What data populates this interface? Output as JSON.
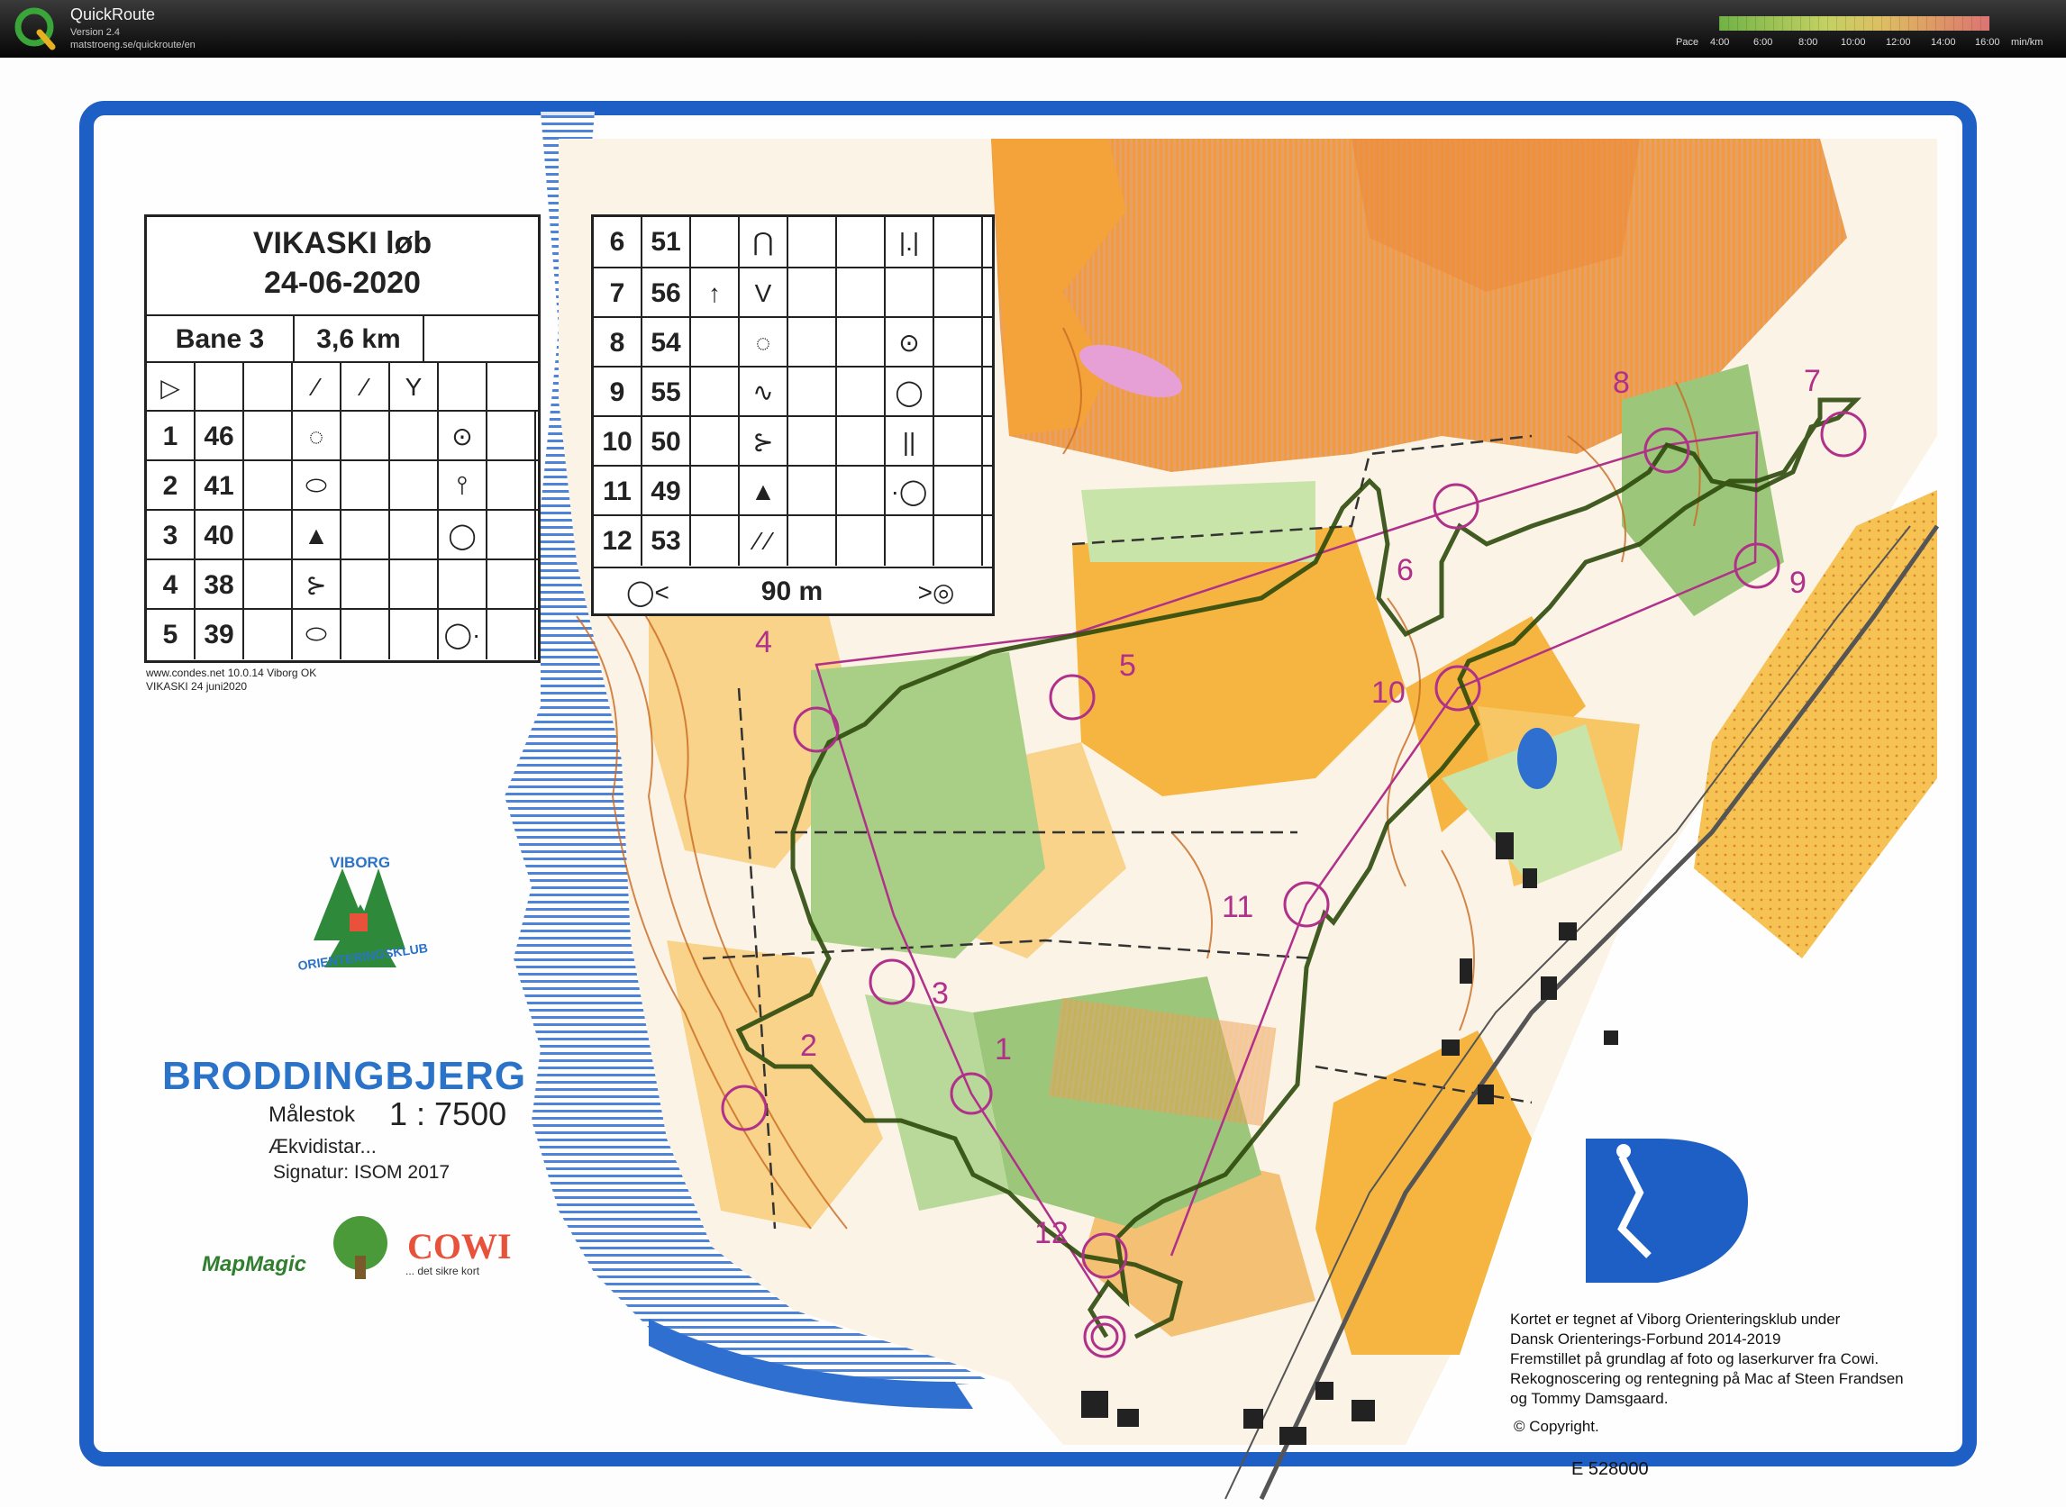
{
  "app": {
    "name": "QuickRoute",
    "version": "Version 2.4",
    "url": "matstroeng.se/quickroute/en",
    "pace_label": "Pace",
    "pace_ticks": [
      "4:00",
      "6:00",
      "8:00",
      "10:00",
      "12:00",
      "14:00",
      "16:00"
    ],
    "pace_unit": "min/km"
  },
  "event": {
    "title": "VIKASKI løb",
    "date": "24-06-2020",
    "course": "Bane 3",
    "length": "3,6 km",
    "finish_distance": "90 m",
    "footer_line1": "www.condes.net 10.0.14 Viborg OK",
    "footer_line2": "VIKASKI 24 juni2020"
  },
  "controls_left": [
    {
      "num": "1",
      "code": "46",
      "sym": "◌",
      "loc": "⊙"
    },
    {
      "num": "2",
      "code": "41",
      "sym": "⬭",
      "loc": "⫯"
    },
    {
      "num": "3",
      "code": "40",
      "sym": "▲",
      "loc": "◯"
    },
    {
      "num": "4",
      "code": "38",
      "sym": "⊱",
      "loc": ""
    },
    {
      "num": "5",
      "code": "39",
      "sym": "⬭",
      "loc": "◯·"
    }
  ],
  "controls_right": [
    {
      "num": "6",
      "code": "51",
      "dir": "",
      "sym": "⋂",
      "loc": "|.|"
    },
    {
      "num": "7",
      "code": "56",
      "dir": "↑",
      "sym": "V",
      "loc": ""
    },
    {
      "num": "8",
      "code": "54",
      "dir": "",
      "sym": "◌",
      "loc": "⊙"
    },
    {
      "num": "9",
      "code": "55",
      "dir": "",
      "sym": "∿",
      "loc": "◯"
    },
    {
      "num": "10",
      "code": "50",
      "dir": "",
      "sym": "⊱",
      "loc": "||"
    },
    {
      "num": "11",
      "code": "49",
      "dir": "",
      "sym": "▲",
      "loc": "·◯"
    },
    {
      "num": "12",
      "code": "53",
      "dir": "",
      "sym": "⁄ ⁄",
      "loc": ""
    }
  ],
  "map": {
    "name": "BRODDINGBJERG",
    "scale_label": "Målestok",
    "scale": "1 : 7500",
    "equidistance": "Ækvidistar...",
    "signature": "Signatur: ISOM 2017",
    "club_top": "VIBORG",
    "club_bottom": "ORIENTERINGSKLUB",
    "mapmagic": "MapMagic",
    "cowi": "COWI",
    "cowi_sub": "... det sikre kort",
    "credits": "Kortet er tegnet af Viborg Orienteringsklub under\nDansk Orienterings-Forbund  2014-2019\nFremstillet på grundlag af foto og laserkurver fra Cowi.\nRekognoscering og rentegning på Mac af Steen Frandsen\nog Tommy Damsgaard.",
    "copyright": "© Copyright.",
    "easting": "E 528000"
  },
  "control_labels": [
    "1",
    "2",
    "3",
    "4",
    "5",
    "6",
    "7",
    "8",
    "9",
    "10",
    "11",
    "12"
  ],
  "colors": {
    "course": "#b0308a",
    "route": "#3a5a12",
    "frame": "#1d5fc4",
    "open_land": "#f4b23a",
    "forest_green": "#9cc77a"
  }
}
